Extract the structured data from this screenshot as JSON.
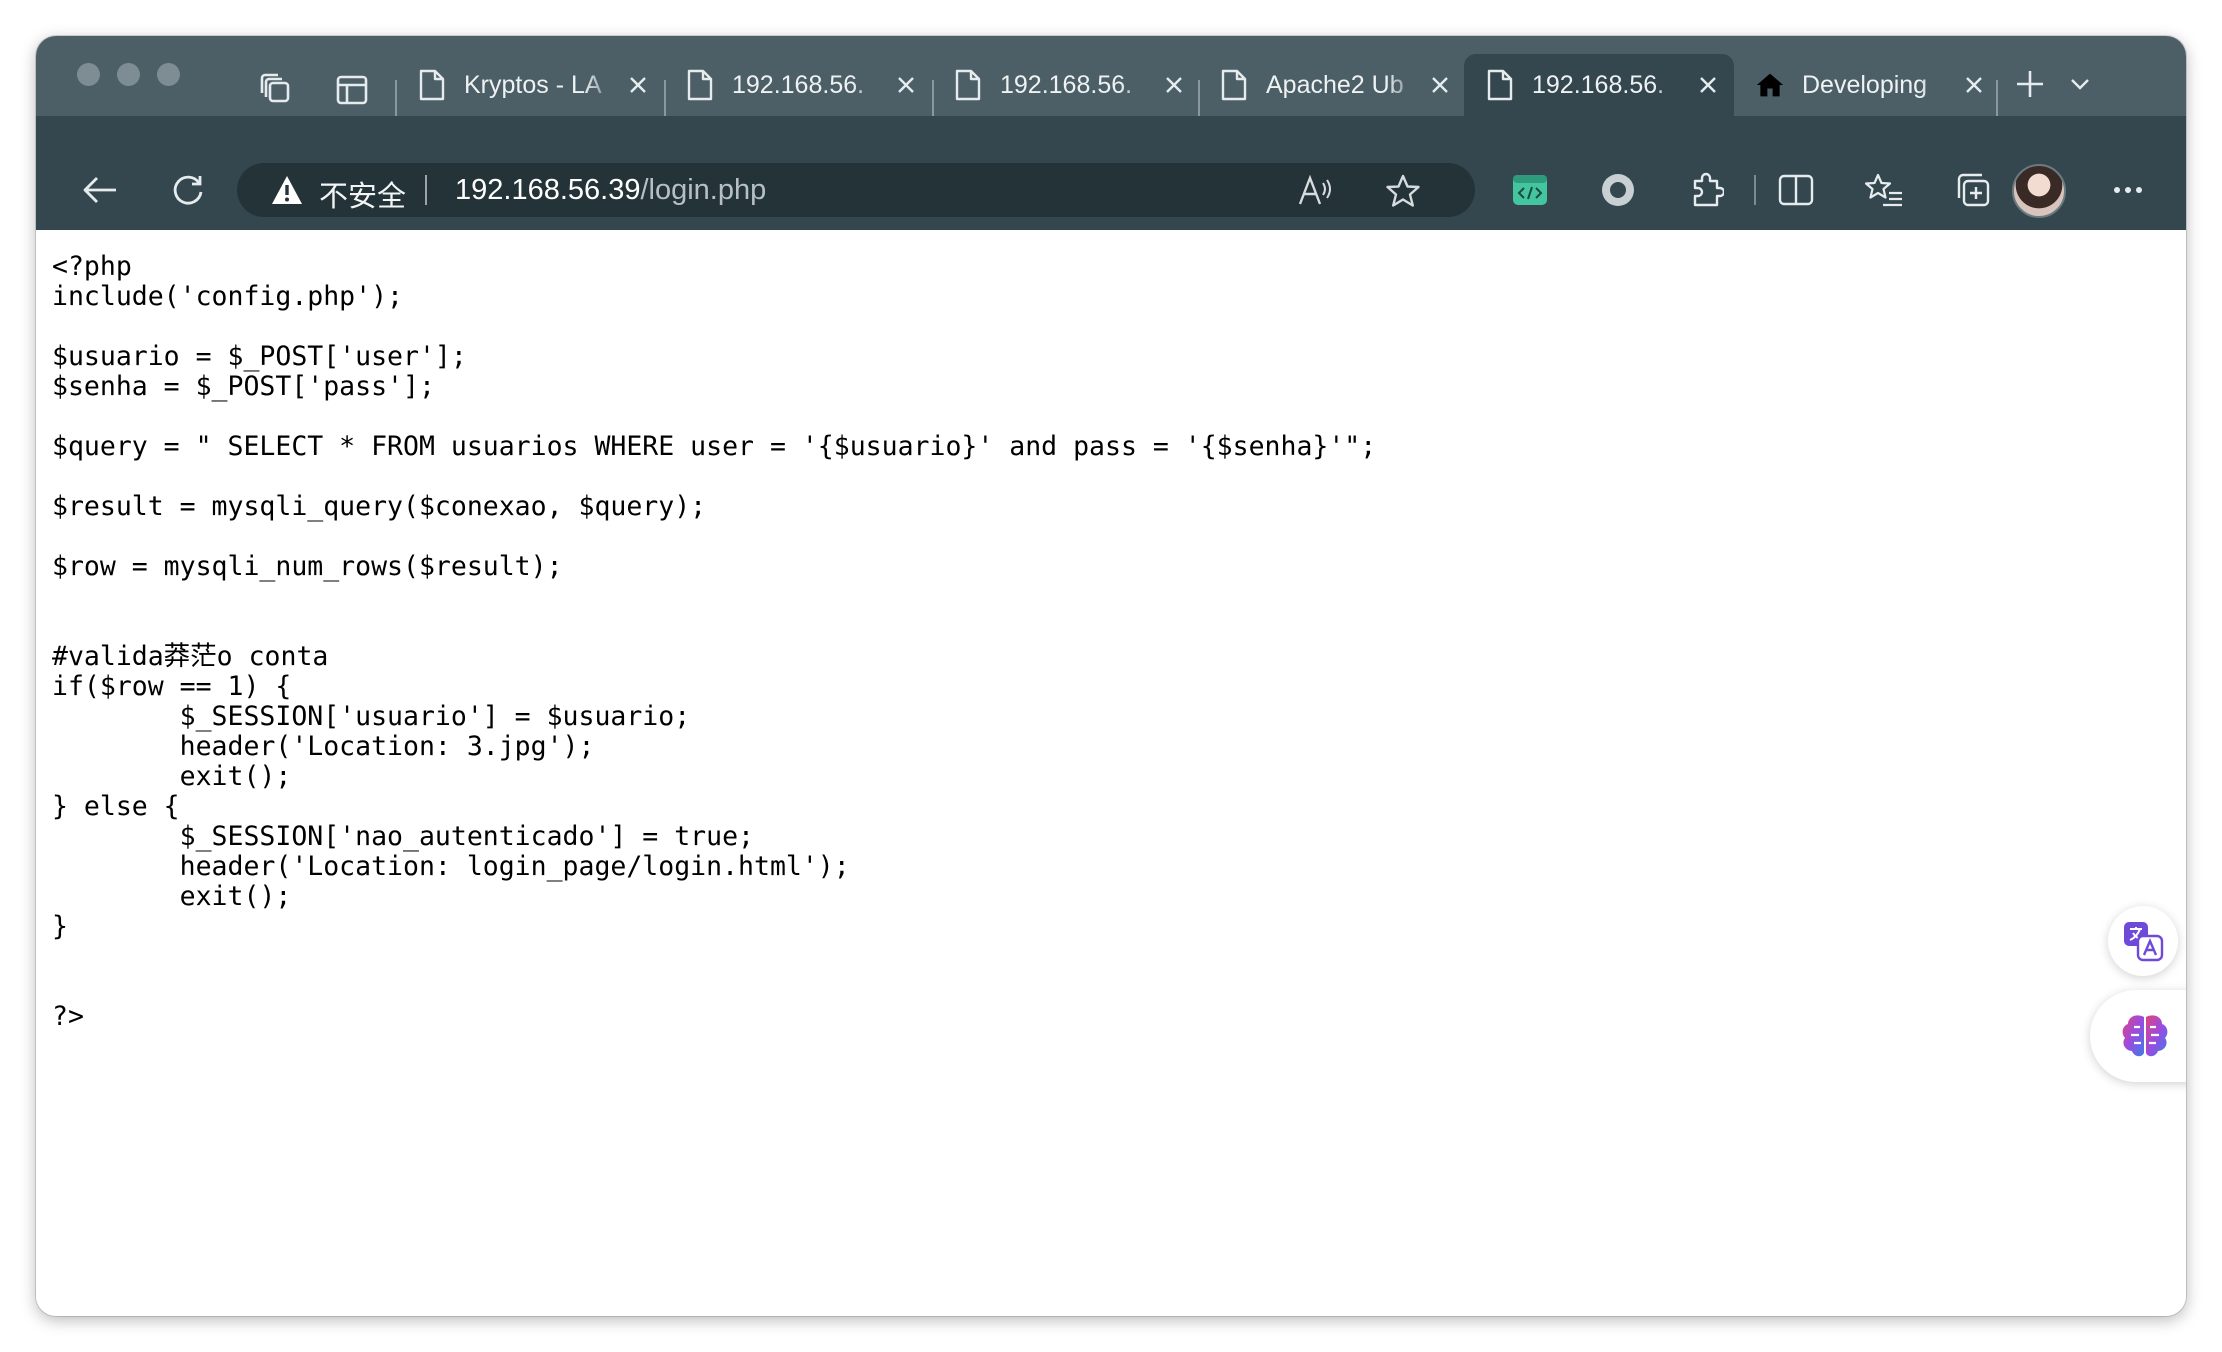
{
  "window": {
    "traffic_lights": [
      "close",
      "minimize",
      "zoom"
    ]
  },
  "tabs": [
    {
      "title": "Kryptos - LA",
      "icon": "document-icon",
      "active": false
    },
    {
      "title": "192.168.56.",
      "icon": "document-icon",
      "active": false
    },
    {
      "title": "192.168.56.",
      "icon": "document-icon",
      "active": false
    },
    {
      "title": "Apache2 Ub",
      "icon": "document-icon",
      "active": false
    },
    {
      "title": "192.168.56.",
      "icon": "document-icon",
      "active": true
    },
    {
      "title": "Developing",
      "icon": "home-icon",
      "active": false
    }
  ],
  "address_bar": {
    "security_label": "不安全",
    "url_host": "192.168.56.39",
    "url_path": "/login.php"
  },
  "page": {
    "source": "<?php\ninclude('config.php');\n\n$usuario = $_POST['user'];\n$senha = $_POST['pass'];\n\n$query = \" SELECT * FROM usuarios WHERE user = '{$usuario}' and pass = '{$senha}'\";\n\n$result = mysqli_query($conexao, $query);\n\n$row = mysqli_num_rows($result);\n\n\n#valida莽茫o conta\nif($row == 1) {\n        $_SESSION['usuario'] = $usuario;\n        header('Location: 3.jpg');\n        exit();\n} else {\n        $_SESSION['nao_autenticado'] = true;\n        header('Location: login_page/login.html');\n        exit();\n}\n\n\n?>"
  },
  "colors": {
    "tabstrip_bg": "#4c5e66",
    "toolbar_bg": "#34474f",
    "addressbar_bg": "#243338",
    "icon_fg": "#e6ecee",
    "accent_green": "#43c6a0"
  }
}
